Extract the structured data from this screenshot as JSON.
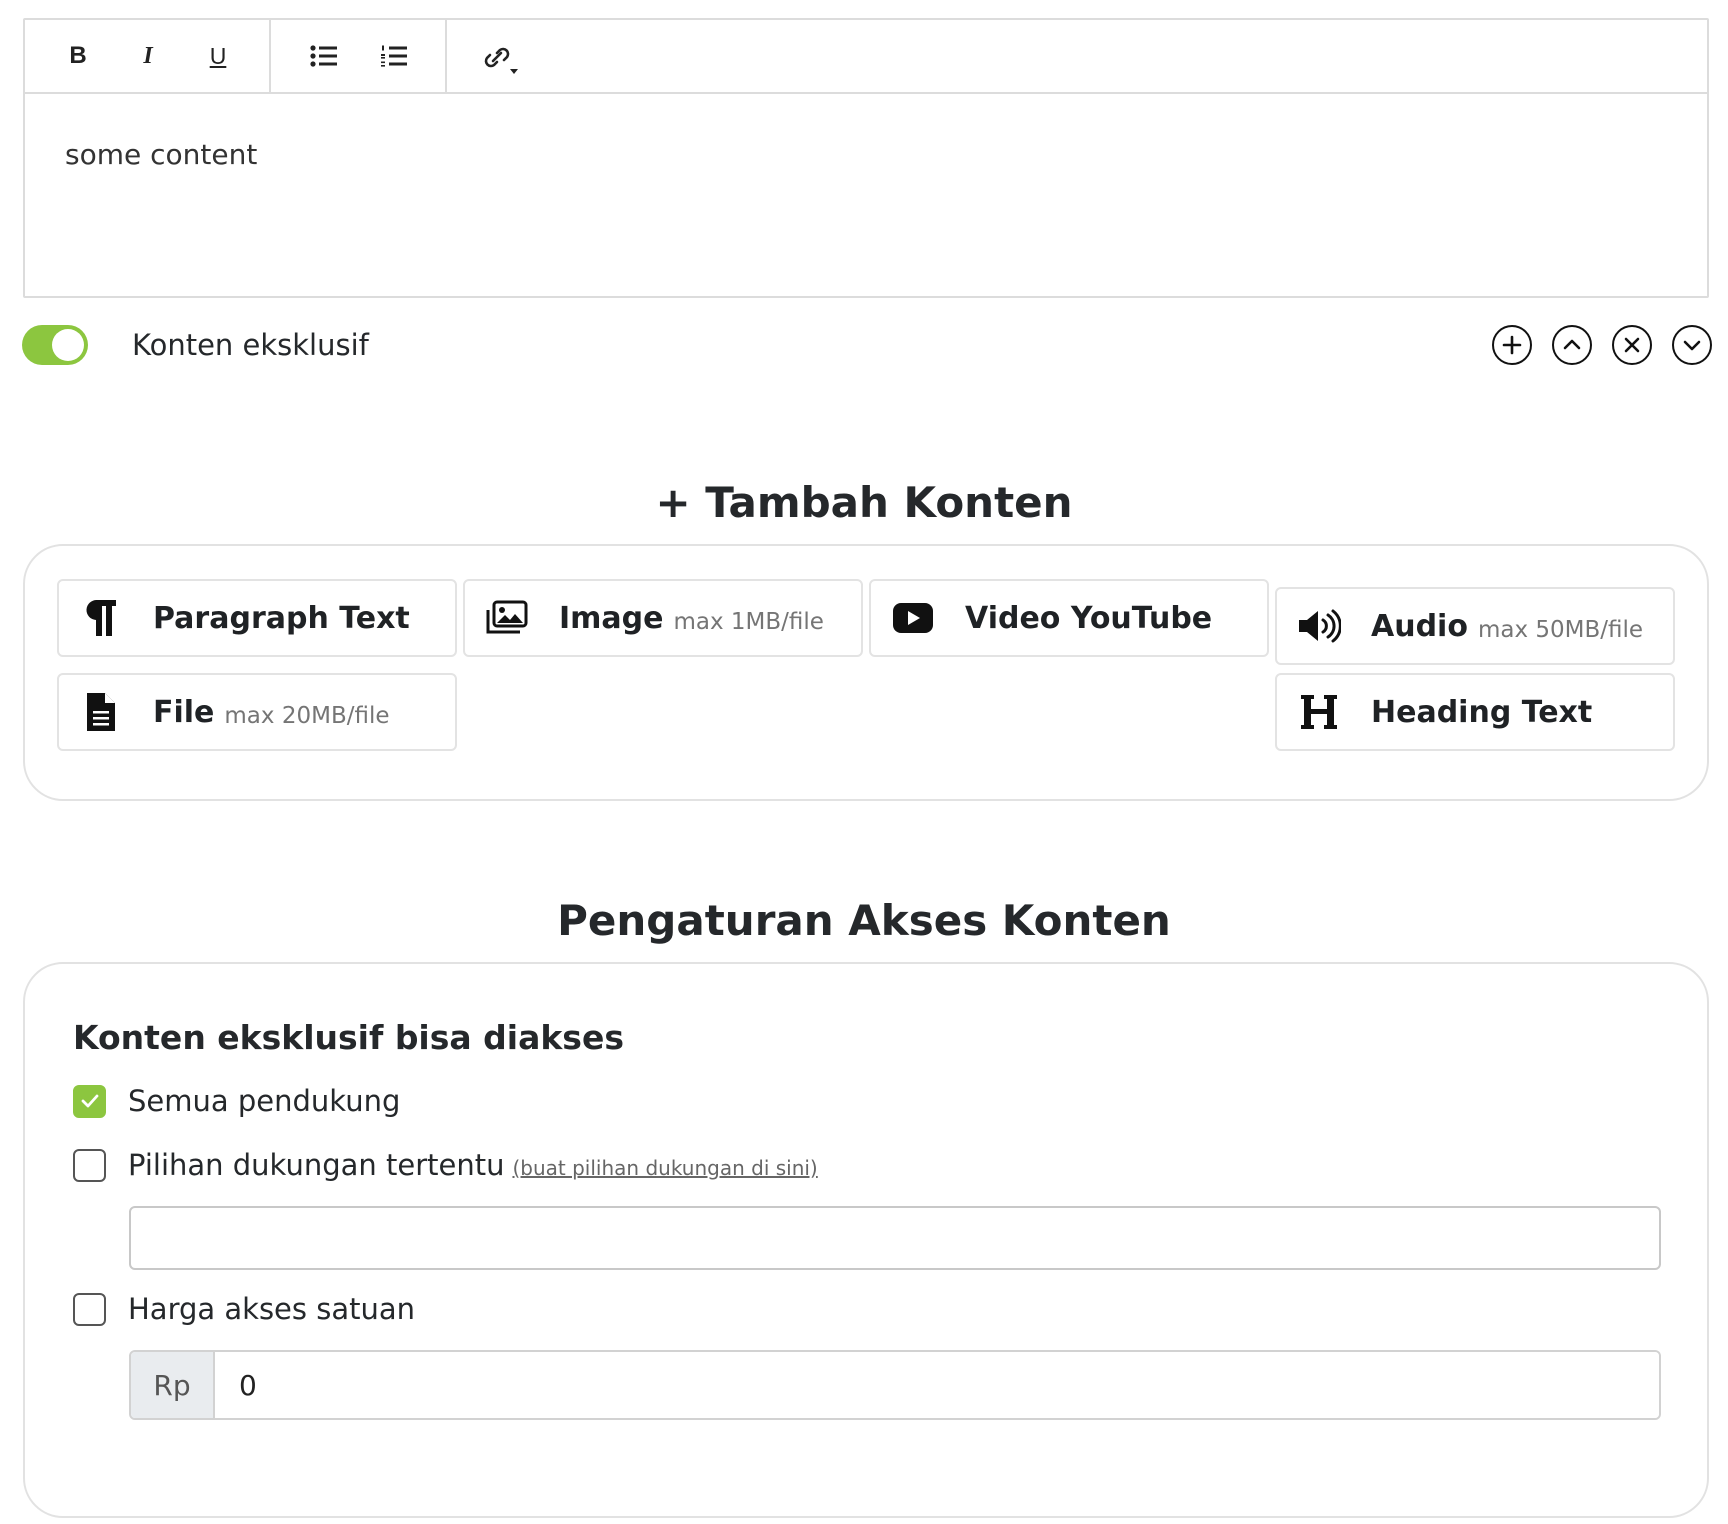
{
  "editor": {
    "toolbar": {
      "bold_label": "B",
      "italic_label": "I",
      "underline_label": "U"
    },
    "content": "some content"
  },
  "exclusive_toggle": {
    "label": "Konten eksklusif",
    "on": true,
    "color": "#8cc63f"
  },
  "row_actions": [
    "plus-circle-icon",
    "chevron-up-circle-icon",
    "x-circle-icon",
    "chevron-down-circle-icon"
  ],
  "add_content": {
    "title": "+ Tambah Konten",
    "types": [
      {
        "label": "Paragraph Text",
        "sub": "",
        "icon": "paragraph-icon"
      },
      {
        "label": "Image",
        "sub": "max 1MB/file",
        "icon": "images-icon"
      },
      {
        "label": "Video YouTube",
        "sub": "",
        "icon": "youtube-icon"
      },
      {
        "label": "Audio",
        "sub": "max 50MB/file",
        "icon": "volume-icon"
      },
      {
        "label": "File",
        "sub": "max 20MB/file",
        "icon": "file-icon"
      },
      {
        "label": "Heading Text",
        "sub": "",
        "icon": "heading-icon"
      }
    ]
  },
  "access": {
    "title": "Pengaturan Akses Konten",
    "subtitle": "Konten eksklusif bisa diakses",
    "options": [
      {
        "label": "Semua pendukung",
        "checked": true
      },
      {
        "label": "Pilihan dukungan tertentu",
        "link": "(buat pilihan dukungan di sini)",
        "checked": false
      },
      {
        "label": "Harga akses satuan",
        "checked": false
      }
    ],
    "tier_input_value": "",
    "price_prefix": "Rp",
    "price_value": "0"
  }
}
